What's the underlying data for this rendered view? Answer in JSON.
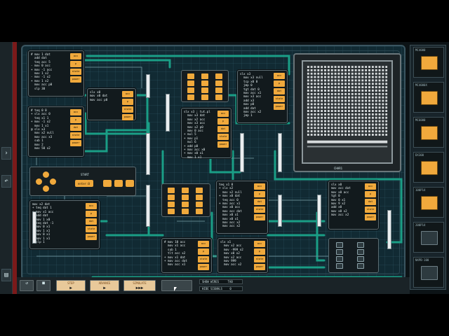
{
  "display": {
    "label": "CHAR1"
  },
  "controller": {
    "start_label": "START",
    "select_label": "enter:0",
    "left_btn": "A",
    "right_btn": "B"
  },
  "toolbar": {
    "step_label": "STEP",
    "advance_label": "ADVANCE",
    "simulate_label": "SIMULATE",
    "step_glyph": "▶",
    "advance_glyph": "▶",
    "simulate_glyph": "▶▶▶",
    "show_wires": "SHOW WIRES",
    "show_wires_key": "TAB",
    "hide_signals": "HIDE SIGNALS",
    "hide_signals_key": "0"
  },
  "palette": [
    {
      "label": "MC4000",
      "dark": false
    },
    {
      "label": "MC4000X",
      "dark": false
    },
    {
      "label": "MC6000",
      "dark": false
    },
    {
      "label": "DX300",
      "dark": false
    },
    {
      "label": "100P14",
      "dark": false
    },
    {
      "label": "200P14",
      "dark": true
    },
    {
      "label": "NXPB-100",
      "dark": true
    }
  ],
  "nodes": [
    {
      "id": "n1",
      "code": "# mov 1 dat\n  add dat\n  teq acc 5\n- mov 0 acc\n+ mov -1 acc\n  mov 1 x2\n- mov -1 x2\n+ mov 1 x2\n  mov acc p0\n  slp 30",
      "regs": [
        "acc",
        "p",
        "state",
        "power"
      ]
    },
    {
      "id": "n2",
      "code": "# teq 0 0\n+ slx acc 0\n  teq x1 1\n+ mov -1 x2\n  mov 1 x1\n@ slx x3\n  mov x2 null\n  mov acc x3\n  sub 1\n  mov 2\n  mov 50 x2",
      "regs": [
        "acc",
        "p",
        "dat",
        "state",
        "power"
      ]
    },
    {
      "id": "n3",
      "code": "slx x0\nmov x0 dat\nmov acc p0",
      "regs": [
        "acc",
        "p",
        "state",
        "power"
      ]
    },
    {
      "id": "n4",
      "code": "slx x3\n  mov x3 null\n  tcp x0 0\n  jmp 0\n  tgt dat 0\n  mov acc x1\n  mov x3 acc\n  add x3\n  mov p0\n  add dat\n  mov acc x2\n  jmp 1",
      "regs": [
        "acc",
        "p",
        "dat",
        "state",
        "power"
      ]
    },
    {
      "id": "n5",
      "code": "slx x3 ; tut.pl\n  mov x3 dat\n  mov x2 acc\n  mov x3 acc\n  mov x2 p0\n  mov 0 acc\n+ mul 5\n+ mov p1\n  mul 6\n+ add p0\n+ mov acc x0\n+ mov x0 x1\n  mov 1 x1",
      "regs": [
        "acc",
        "p",
        "dat",
        "state",
        "power"
      ]
    },
    {
      "id": "n6",
      "code": "mov x2 dat\n+ teq dat 1\n+ mov x1 acc\n  add dat\n+ mov 1 x0\n+ teq dat -1\n+ mov 0 x1\n- mov 1 x1\n  mov 0 x1\n- mov 1 x1\n  slp 1",
      "regs": [
        "acc",
        "p",
        "dat",
        "state",
        "power"
      ]
    },
    {
      "id": "n7",
      "code": "teq x1 0\n+ slx x2\n  mov x2 null\n+ mov x0 dat\n  teq acc 0\n+ mov acc x1\n  mov x0 acc\n  mov acc dat\n  mov x0 x1\n  mov x0 x1\n  mov acc x2\n  mov acc x2",
      "regs": [
        "acc",
        "p",
        "dat",
        "state",
        "power"
      ]
    },
    {
      "id": "n8",
      "code": "slx x0\nmov acc dat\nmov x0 acc\ntgt 0\nmov 0 x1\nmov 9 x2\nadd x0\nmov x0 x2\nmov acc x2",
      "regs": [
        "acc",
        "p",
        "dat",
        "state",
        "power"
      ]
    },
    {
      "id": "n9",
      "code": "# mov 10 acc\n  mov x1 acc\n  sub 1\n  tlt acc x2\n+ mov x1 dat\n+ mov acc dat\n  mov acc x1",
      "regs": [
        "acc",
        "p",
        "state",
        "power"
      ]
    },
    {
      "id": "n10",
      "code": "slx x1\n  mov x2 acc\n  mov -999 x2\n  mov x0 x2\n  mov x2 acc\n  mov 999\n  mov acc x2",
      "regs": [
        "acc",
        "p",
        "state",
        "power"
      ]
    }
  ]
}
